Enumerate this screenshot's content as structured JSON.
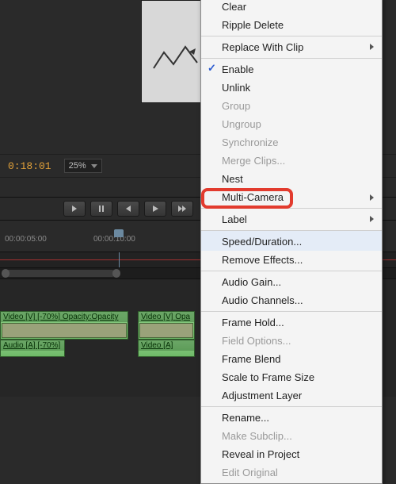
{
  "infobar": {
    "timecode": "0:18:01",
    "zoom": "25%"
  },
  "ruler": {
    "t1": "00:00:05:00",
    "t2": "00:00:10:00"
  },
  "clips": {
    "v1_label": "Video [V] [-70%]",
    "v1_fx": "Opacity:Opacity",
    "v2_label": "Video [V]",
    "v2_fx": "Opa",
    "a1_label": "Audio [A] [-70%]",
    "a2_label": "Video [A]"
  },
  "menu": {
    "clear": "Clear",
    "ripple_delete": "Ripple Delete",
    "replace_with_clip": "Replace With Clip",
    "enable": "Enable",
    "unlink": "Unlink",
    "group": "Group",
    "ungroup": "Ungroup",
    "synchronize": "Synchronize",
    "merge_clips": "Merge Clips...",
    "nest": "Nest",
    "multi_camera": "Multi-Camera",
    "label": "Label",
    "speed_duration": "Speed/Duration...",
    "remove_effects": "Remove Effects...",
    "audio_gain": "Audio Gain...",
    "audio_channels": "Audio Channels...",
    "frame_hold": "Frame Hold...",
    "field_options": "Field Options...",
    "frame_blend": "Frame Blend",
    "scale_to_frame": "Scale to Frame Size",
    "adjustment_layer": "Adjustment Layer",
    "rename": "Rename...",
    "make_subclip": "Make Subclip...",
    "reveal_in_project": "Reveal in Project",
    "edit_original": "Edit Original"
  }
}
